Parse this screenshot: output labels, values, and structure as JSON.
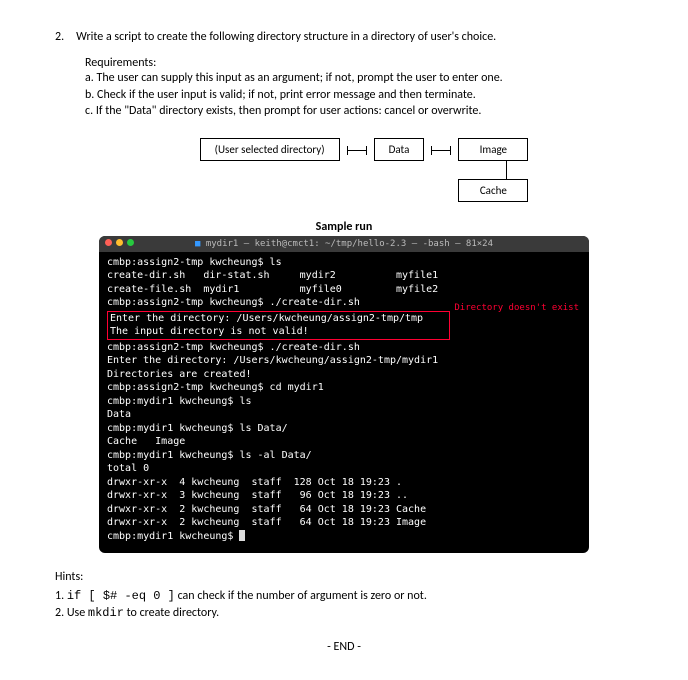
{
  "question": {
    "number": "2.",
    "prompt": "Write a script to create the following directory structure in a directory of user's choice.",
    "requirements_label": "Requirements:",
    "requirements": [
      "a. The user can supply this input as an argument; if not, prompt the user to enter one.",
      "b. Check if the user input is valid; if not, print error message and then terminate.",
      "c. If the \"Data\" directory exists, then prompt for user actions: cancel or overwrite."
    ]
  },
  "diagram": {
    "root": "(User selected directory)",
    "data": "Data",
    "image": "Image",
    "cache": "Cache"
  },
  "sample_run_label": "Sample run",
  "terminal": {
    "title": "mydir1 — keith@cmct1: ~/tmp/hello-2.3 — -bash — 81×24",
    "title_icon": "■",
    "lines": [
      "cmbp:assign2-tmp kwcheung$ ls",
      "create-dir.sh   dir-stat.sh     mydir2          myfile1",
      "create-file.sh  mydir1          myfile0         myfile2",
      "cmbp:assign2-tmp kwcheung$ ./create-dir.sh"
    ],
    "warn_box": [
      "Enter the directory: /Users/kwcheung/assign2-tmp/tmp",
      "The input directory is not valid!"
    ],
    "warn_label": "Directory doesn't exist",
    "lines2": [
      "cmbp:assign2-tmp kwcheung$ ./create-dir.sh",
      "Enter the directory: /Users/kwcheung/assign2-tmp/mydir1",
      "Directories are created!",
      "cmbp:assign2-tmp kwcheung$ cd mydir1",
      "cmbp:mydir1 kwcheung$ ls",
      "Data",
      "cmbp:mydir1 kwcheung$ ls Data/",
      "Cache   Image",
      "cmbp:mydir1 kwcheung$ ls -al Data/",
      "total 0",
      "drwxr-xr-x  4 kwcheung  staff  128 Oct 18 19:23 .",
      "drwxr-xr-x  3 kwcheung  staff   96 Oct 18 19:23 ..",
      "drwxr-xr-x  2 kwcheung  staff   64 Oct 18 19:23 Cache",
      "drwxr-xr-x  2 kwcheung  staff   64 Oct 18 19:23 Image",
      "cmbp:mydir1 kwcheung$ "
    ]
  },
  "hints": {
    "label": "Hints:",
    "h1_pre": "1. ",
    "h1_code": "if [ $# -eq 0 ]",
    "h1_post": " can check if the number of argument is zero or not.",
    "h2_pre": "2. Use ",
    "h2_code": "mkdir",
    "h2_post": " to create directory."
  },
  "end": "- END -"
}
